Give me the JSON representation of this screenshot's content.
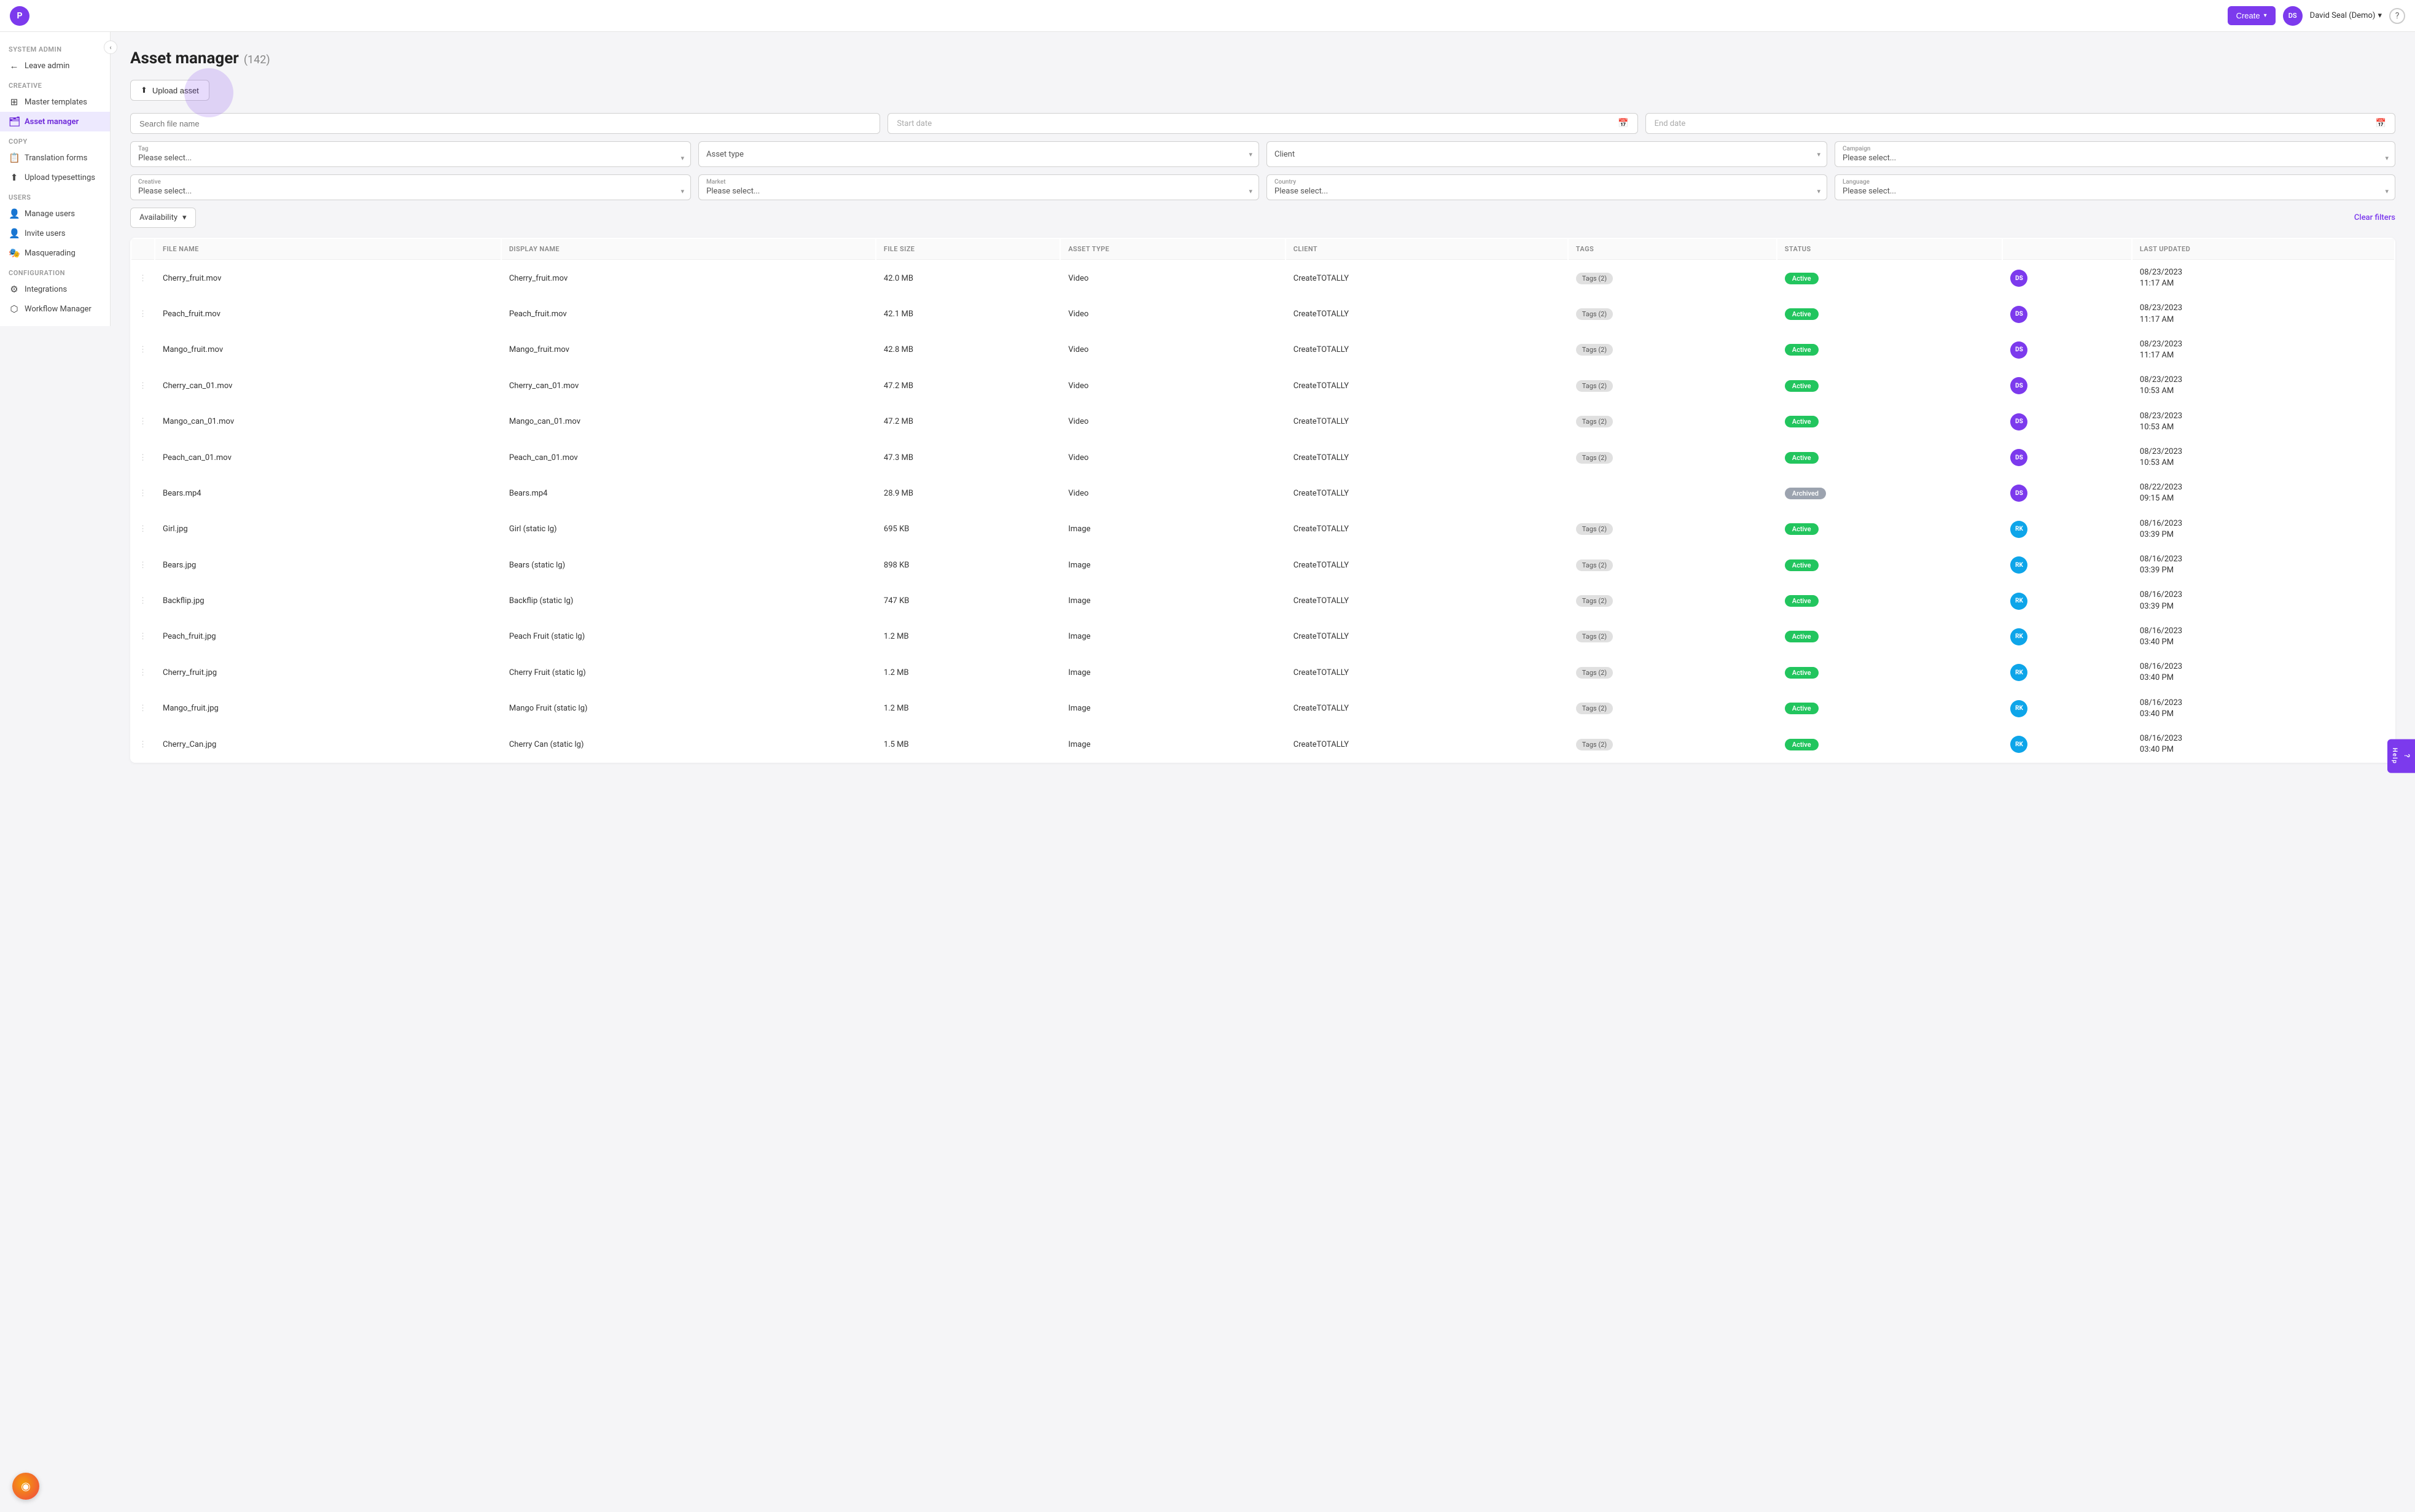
{
  "app": {
    "logo_text": "P",
    "title": "Asset manager"
  },
  "header": {
    "create_label": "Create",
    "user_initials": "DS",
    "user_name": "David Seal (Demo)",
    "help_label": "?"
  },
  "sidebar": {
    "collapse_icon": "‹",
    "system_admin_label": "System admin",
    "leave_admin_label": "Leave admin",
    "creative_label": "Creative",
    "items": [
      {
        "id": "master-templates",
        "label": "Master templates",
        "icon": "⊞",
        "active": false
      },
      {
        "id": "asset-manager",
        "label": "Asset manager",
        "icon": "🗂",
        "active": true
      }
    ],
    "copy_label": "Copy",
    "copy_items": [
      {
        "id": "translation-forms",
        "label": "Translation forms",
        "icon": "📋",
        "active": false
      },
      {
        "id": "upload-typesettings",
        "label": "Upload typesettings",
        "icon": "⬆",
        "active": false
      }
    ],
    "users_label": "Users",
    "users_items": [
      {
        "id": "manage-users",
        "label": "Manage users",
        "icon": "👤",
        "active": false
      },
      {
        "id": "invite-users",
        "label": "Invite users",
        "icon": "👤+",
        "active": false
      },
      {
        "id": "masquerading",
        "label": "Masquerading",
        "icon": "🎭",
        "active": false
      }
    ],
    "config_label": "Configuration",
    "config_items": [
      {
        "id": "integrations",
        "label": "Integrations",
        "icon": "⚙",
        "active": false
      },
      {
        "id": "workflow-manager",
        "label": "Workflow Manager",
        "icon": "⬡",
        "active": false
      }
    ]
  },
  "page": {
    "title": "Asset manager",
    "count": "(142)",
    "upload_btn_label": "Upload asset"
  },
  "filters": {
    "search_placeholder": "Search file name",
    "start_date_placeholder": "Start date",
    "end_date_placeholder": "End date",
    "tag_label": "Tag",
    "tag_placeholder": "Please select...",
    "asset_type_label": "Asset type",
    "asset_type_placeholder": "Asset type",
    "client_label": "Client",
    "client_placeholder": "Client",
    "campaign_label": "Campaign",
    "campaign_placeholder": "Please select...",
    "creative_label": "Creative",
    "creative_placeholder": "Please select...",
    "market_label": "Market",
    "market_placeholder": "Please select...",
    "country_label": "Country",
    "country_placeholder": "Please select...",
    "language_label": "Language",
    "language_placeholder": "Please select...",
    "availability_label": "Availability",
    "clear_filters_label": "Clear filters"
  },
  "table": {
    "columns": [
      {
        "id": "menu",
        "label": ""
      },
      {
        "id": "file_name",
        "label": "FILE NAME"
      },
      {
        "id": "display_name",
        "label": "DISPLAY NAME"
      },
      {
        "id": "file_size",
        "label": "FILE SIZE"
      },
      {
        "id": "asset_type",
        "label": "ASSET TYPE"
      },
      {
        "id": "client",
        "label": "CLIENT"
      },
      {
        "id": "tags",
        "label": "TAGS"
      },
      {
        "id": "status",
        "label": "STATUS"
      },
      {
        "id": "avatar",
        "label": ""
      },
      {
        "id": "last_updated",
        "label": "LAST UPDATED"
      }
    ],
    "rows": [
      {
        "menu": "⋮",
        "file_name": "Cherry_fruit.mov",
        "display_name": "Cherry_fruit.mov",
        "file_size": "42.0 MB",
        "asset_type": "Video",
        "client": "CreateTOTALLY",
        "tags": "Tags (2)",
        "status": "Active",
        "avatar_initials": "DS",
        "avatar_class": "av-ds",
        "last_updated": "08/23/2023\n11:17 AM"
      },
      {
        "menu": "⋮",
        "file_name": "Peach_fruit.mov",
        "display_name": "Peach_fruit.mov",
        "file_size": "42.1 MB",
        "asset_type": "Video",
        "client": "CreateTOTALLY",
        "tags": "Tags (2)",
        "status": "Active",
        "avatar_initials": "DS",
        "avatar_class": "av-ds",
        "last_updated": "08/23/2023\n11:17 AM"
      },
      {
        "menu": "⋮",
        "file_name": "Mango_fruit.mov",
        "display_name": "Mango_fruit.mov",
        "file_size": "42.8 MB",
        "asset_type": "Video",
        "client": "CreateTOTALLY",
        "tags": "Tags (2)",
        "status": "Active",
        "avatar_initials": "DS",
        "avatar_class": "av-ds",
        "last_updated": "08/23/2023\n11:17 AM"
      },
      {
        "menu": "⋮",
        "file_name": "Cherry_can_01.mov",
        "display_name": "Cherry_can_01.mov",
        "file_size": "47.2 MB",
        "asset_type": "Video",
        "client": "CreateTOTALLY",
        "tags": "Tags (2)",
        "status": "Active",
        "avatar_initials": "DS",
        "avatar_class": "av-ds",
        "last_updated": "08/23/2023\n10:53 AM"
      },
      {
        "menu": "⋮",
        "file_name": "Mango_can_01.mov",
        "display_name": "Mango_can_01.mov",
        "file_size": "47.2 MB",
        "asset_type": "Video",
        "client": "CreateTOTALLY",
        "tags": "Tags (2)",
        "status": "Active",
        "avatar_initials": "DS",
        "avatar_class": "av-ds",
        "last_updated": "08/23/2023\n10:53 AM"
      },
      {
        "menu": "⋮",
        "file_name": "Peach_can_01.mov",
        "display_name": "Peach_can_01.mov",
        "file_size": "47.3 MB",
        "asset_type": "Video",
        "client": "CreateTOTALLY",
        "tags": "Tags (2)",
        "status": "Active",
        "avatar_initials": "DS",
        "avatar_class": "av-ds",
        "last_updated": "08/23/2023\n10:53 AM"
      },
      {
        "menu": "⋮",
        "file_name": "Bears.mp4",
        "display_name": "Bears.mp4",
        "file_size": "28.9 MB",
        "asset_type": "Video",
        "client": "CreateTOTALLY",
        "tags": "",
        "status": "Archived",
        "avatar_initials": "DS",
        "avatar_class": "av-ds",
        "last_updated": "08/22/2023\n09:15 AM"
      },
      {
        "menu": "⋮",
        "file_name": "Girl.jpg",
        "display_name": "Girl (static lg)",
        "file_size": "695 KB",
        "asset_type": "Image",
        "client": "CreateTOTALLY",
        "tags": "Tags (2)",
        "status": "Active",
        "avatar_initials": "RK",
        "avatar_class": "av-rk",
        "last_updated": "08/16/2023\n03:39 PM"
      },
      {
        "menu": "⋮",
        "file_name": "Bears.jpg",
        "display_name": "Bears (static lg)",
        "file_size": "898 KB",
        "asset_type": "Image",
        "client": "CreateTOTALLY",
        "tags": "Tags (2)",
        "status": "Active",
        "avatar_initials": "RK",
        "avatar_class": "av-rk",
        "last_updated": "08/16/2023\n03:39 PM"
      },
      {
        "menu": "⋮",
        "file_name": "Backflip.jpg",
        "display_name": "Backflip (static lg)",
        "file_size": "747 KB",
        "asset_type": "Image",
        "client": "CreateTOTALLY",
        "tags": "Tags (2)",
        "status": "Active",
        "avatar_initials": "RK",
        "avatar_class": "av-rk",
        "last_updated": "08/16/2023\n03:39 PM"
      },
      {
        "menu": "⋮",
        "file_name": "Peach_fruit.jpg",
        "display_name": "Peach Fruit (static lg)",
        "file_size": "1.2 MB",
        "asset_type": "Image",
        "client": "CreateTOTALLY",
        "tags": "Tags (2)",
        "status": "Active",
        "avatar_initials": "RK",
        "avatar_class": "av-rk",
        "last_updated": "08/16/2023\n03:40 PM"
      },
      {
        "menu": "⋮",
        "file_name": "Cherry_fruit.jpg",
        "display_name": "Cherry Fruit (static lg)",
        "file_size": "1.2 MB",
        "asset_type": "Image",
        "client": "CreateTOTALLY",
        "tags": "Tags (2)",
        "status": "Active",
        "avatar_initials": "RK",
        "avatar_class": "av-rk",
        "last_updated": "08/16/2023\n03:40 PM"
      },
      {
        "menu": "⋮",
        "file_name": "Mango_fruit.jpg",
        "display_name": "Mango Fruit (static lg)",
        "file_size": "1.2 MB",
        "asset_type": "Image",
        "client": "CreateTOTALLY",
        "tags": "Tags (2)",
        "status": "Active",
        "avatar_initials": "RK",
        "avatar_class": "av-rk",
        "last_updated": "08/16/2023\n03:40 PM"
      },
      {
        "menu": "⋮",
        "file_name": "Cherry_Can.jpg",
        "display_name": "Cherry Can (static lg)",
        "file_size": "1.5 MB",
        "asset_type": "Image",
        "client": "CreateTOTALLY",
        "tags": "Tags (2)",
        "status": "Active",
        "avatar_initials": "RK",
        "avatar_class": "av-rk",
        "last_updated": "08/16/2023\n03:40 PM"
      }
    ]
  },
  "help": {
    "label": "Help"
  },
  "support": {
    "beacon_label": "●"
  }
}
